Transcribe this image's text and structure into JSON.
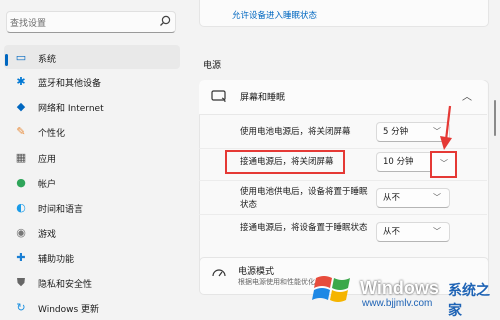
{
  "sidebar": {
    "search_placeholder": "查找设置",
    "items": [
      {
        "label": "系统",
        "icon": "monitor-icon",
        "color": "#0067c0"
      },
      {
        "label": "蓝牙和其他设备",
        "icon": "bluetooth-icon",
        "color": "#0078d4"
      },
      {
        "label": "网络和 Internet",
        "icon": "wifi-icon",
        "color": "#0067c0"
      },
      {
        "label": "个性化",
        "icon": "brush-icon",
        "color": "#e88b3a"
      },
      {
        "label": "应用",
        "icon": "apps-icon",
        "color": "#555555"
      },
      {
        "label": "帐户",
        "icon": "person-icon",
        "color": "#2fa55a"
      },
      {
        "label": "时间和语言",
        "icon": "globe-clock-icon",
        "color": "#1a9be8"
      },
      {
        "label": "游戏",
        "icon": "gamepad-icon",
        "color": "#777777"
      },
      {
        "label": "辅助功能",
        "icon": "accessibility-icon",
        "color": "#1a7fd4"
      },
      {
        "label": "隐私和安全性",
        "icon": "shield-icon",
        "color": "#666666"
      },
      {
        "label": "Windows 更新",
        "icon": "sync-icon",
        "color": "#1a8fe0"
      }
    ]
  },
  "main": {
    "sleep_link": "允许设备进入睡眠状态",
    "section_title": "电源",
    "power_header": "屏幕和睡眠",
    "rows": [
      {
        "label": "使用电池电源后，将关闭屏幕",
        "value": "5 分钟"
      },
      {
        "label": "接通电源后，将关闭屏幕",
        "value": "10 分钟"
      },
      {
        "label": "使用电池供电后，设备将置于睡眠状态",
        "value": "从不"
      },
      {
        "label": "接通电源后，将设备置于睡眠状态",
        "value": "从不"
      }
    ],
    "power_mode_title": "电源模式",
    "power_mode_sub": "根据电源使用和性能优化设备"
  },
  "watermark": {
    "brand": "Windows",
    "brand_cn": "系统之家",
    "url": "www.bjjmlv.com"
  },
  "colors": {
    "accent": "#0067c0",
    "highlight": "#e53935"
  }
}
